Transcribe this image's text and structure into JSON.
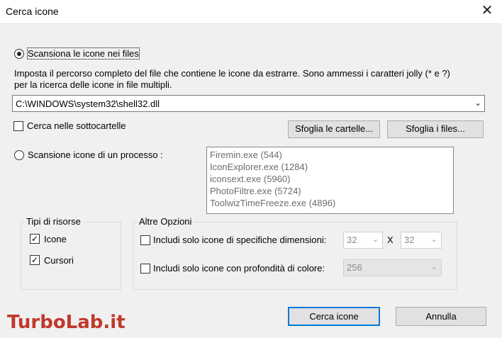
{
  "window": {
    "title": "Cerca icone"
  },
  "scan_files": {
    "label": "Scansiona le icone nei files",
    "description_line1": "Imposta il percorso completo del file che contiene le icone da estrarre. Sono ammessi i caratteri jolly (* e ?)",
    "description_line2": "per la ricerca delle icone in file multipli.",
    "path_value": "C:\\WINDOWS\\system32\\shell32.dll",
    "subfolders_label": "Cerca nelle sottocartelle",
    "browse_folders_label": "Sfoglia le cartelle...",
    "browse_files_label": "Sfoglia i files..."
  },
  "scan_process": {
    "label": "Scansione icone di un processo :",
    "processes": [
      "Firemin.exe  (544)",
      "IconExplorer.exe  (1284)",
      "iconsext.exe  (5960)",
      "PhotoFiltre.exe  (5724)",
      "ToolwizTimeFreeze.exe  (4896)"
    ]
  },
  "resource_types": {
    "title": "Tipi di risorse",
    "icons_label": "Icone",
    "cursors_label": "Cursori"
  },
  "other_options": {
    "title": "Altre Opzioni",
    "size_label": "Includi solo icone di specifiche dimensioni:",
    "width_value": "32",
    "times": "X",
    "height_value": "32",
    "depth_label": "Includi solo icone con profondità di colore:",
    "depth_value": "256"
  },
  "footer": {
    "search_label": "Cerca icone",
    "cancel_label": "Annulla"
  },
  "watermark": {
    "text": "TurboLab.it"
  }
}
